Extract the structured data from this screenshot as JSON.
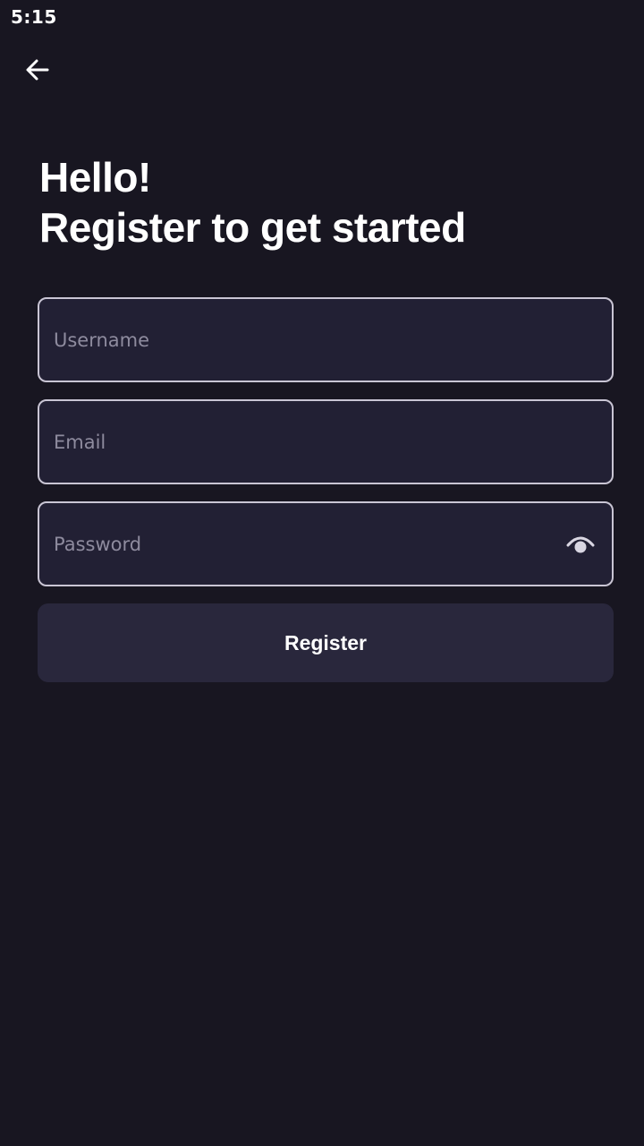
{
  "status_bar": {
    "time": "5:15"
  },
  "nav": {
    "back_icon": "arrow-left-icon"
  },
  "heading": {
    "line1": "Hello!",
    "line2": "Register to get started"
  },
  "form": {
    "username": {
      "placeholder": "Username",
      "value": ""
    },
    "email": {
      "placeholder": "Email",
      "value": ""
    },
    "password": {
      "placeholder": "Password",
      "value": "",
      "toggle_icon": "eye-icon"
    },
    "submit_label": "Register"
  },
  "colors": {
    "background": "#181621",
    "field_background": "#222034",
    "field_border": "#c9c5d4",
    "button_background": "#29273c",
    "placeholder": "#8e8b9e",
    "text": "#ffffff"
  }
}
